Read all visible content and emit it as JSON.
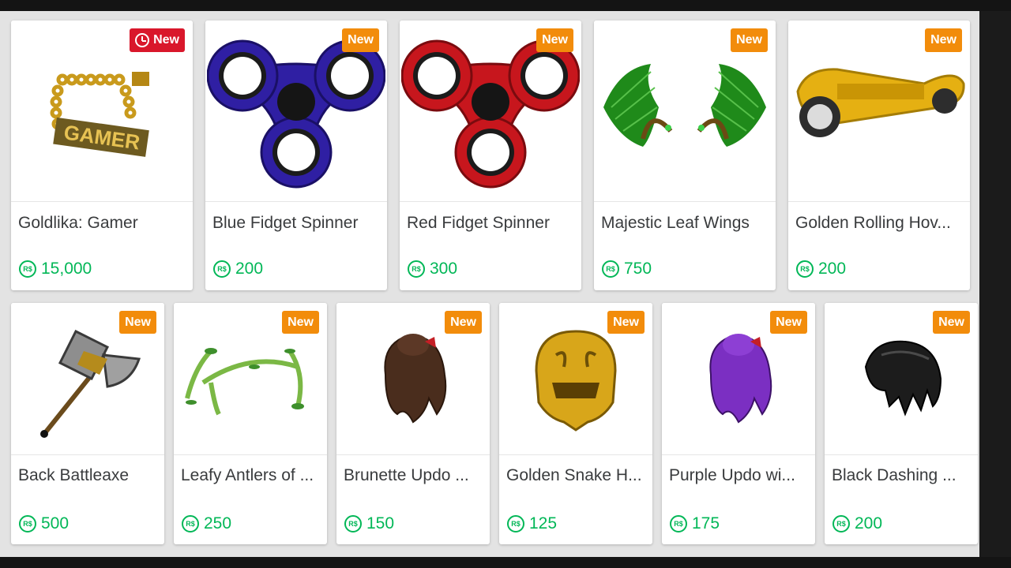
{
  "catalog": {
    "row1": [
      {
        "name": "Goldlika: Gamer",
        "price": "15,000",
        "badge": "New",
        "badge_style": "timed",
        "thumb": "gold-gamer-chain"
      },
      {
        "name": "Blue Fidget Spinner",
        "price": "200",
        "badge": "New",
        "badge_style": "standard",
        "thumb": "blue-fidget-spinner"
      },
      {
        "name": "Red Fidget Spinner",
        "price": "300",
        "badge": "New",
        "badge_style": "standard",
        "thumb": "red-fidget-spinner"
      },
      {
        "name": "Majestic Leaf Wings",
        "price": "750",
        "badge": "New",
        "badge_style": "standard",
        "thumb": "leaf-wings"
      },
      {
        "name": "Golden Rolling Hov...",
        "price": "200",
        "badge": "New",
        "badge_style": "standard",
        "thumb": "golden-hoverboard"
      }
    ],
    "row2": [
      {
        "name": "Back Battleaxe",
        "price": "500",
        "badge": "New",
        "thumb": "battleaxe"
      },
      {
        "name": "Leafy Antlers of ...",
        "price": "250",
        "badge": "New",
        "thumb": "leafy-antlers"
      },
      {
        "name": "Brunette Updo ...",
        "price": "150",
        "badge": "New",
        "thumb": "brunette-updo"
      },
      {
        "name": "Golden Snake H...",
        "price": "125",
        "badge": "New",
        "thumb": "golden-snake-helm"
      },
      {
        "name": "Purple Updo wi...",
        "price": "175",
        "badge": "New",
        "thumb": "purple-updo"
      },
      {
        "name": "Black Dashing ...",
        "price": "200",
        "badge": "New",
        "thumb": "black-dashing-hair"
      }
    ]
  },
  "currency_icon": "robux-icon",
  "colors": {
    "price": "#02b757",
    "badge": "#f28c0b",
    "badge_timed": "#d9172b",
    "page_bg": "#e3e3e3"
  }
}
